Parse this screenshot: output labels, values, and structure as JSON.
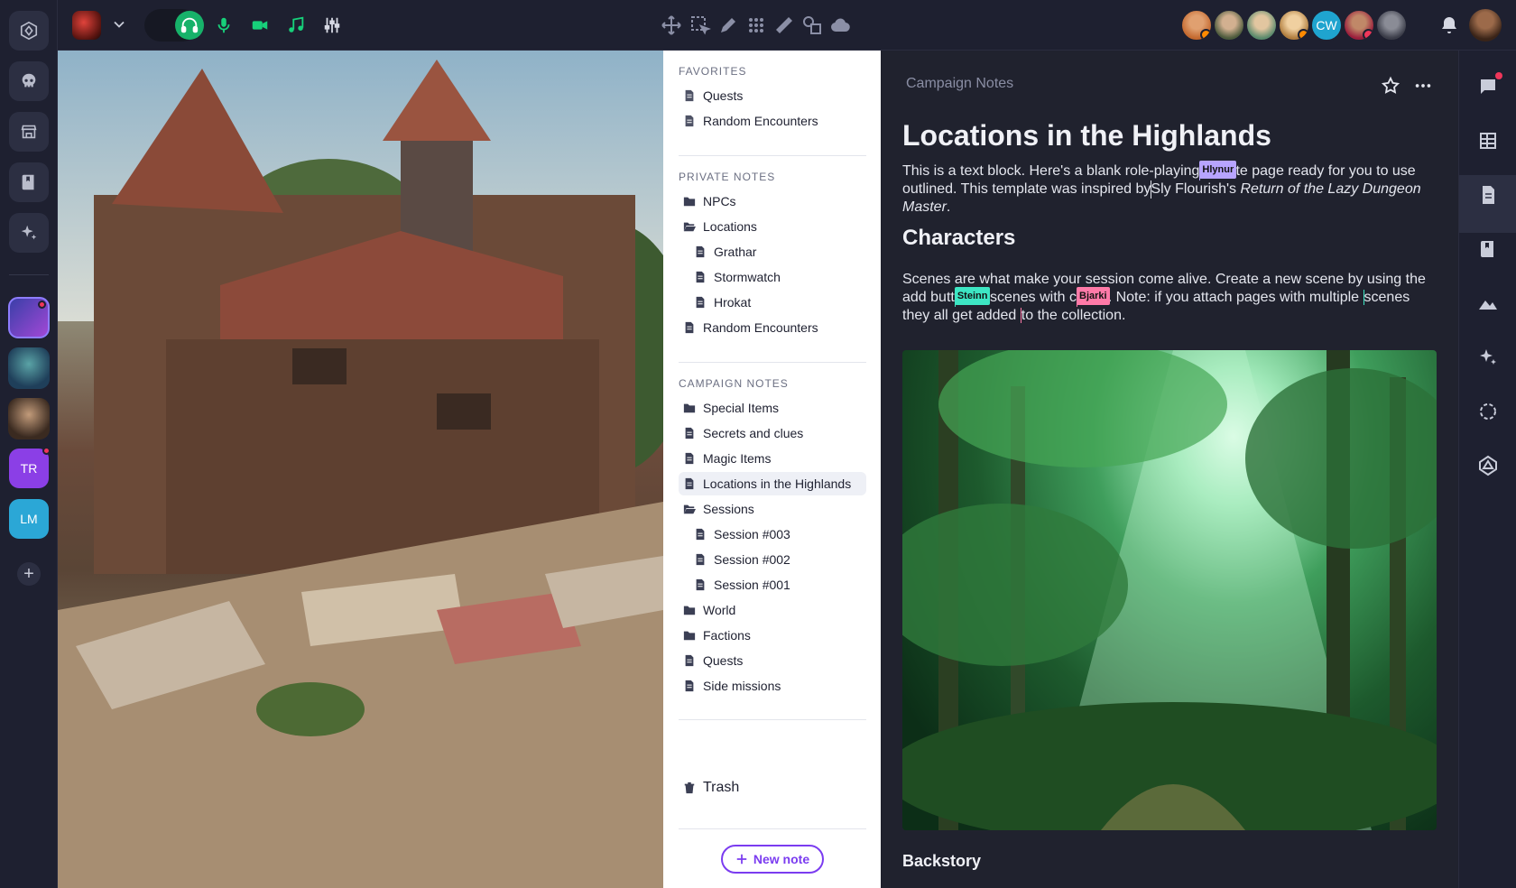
{
  "rail": {
    "items": [
      {
        "name": "app-logo-icon"
      },
      {
        "name": "skull-icon"
      },
      {
        "name": "store-icon"
      },
      {
        "name": "book-icon"
      },
      {
        "name": "sparkle-icon"
      }
    ],
    "groups": [
      {
        "initials": "TR",
        "color": "#8b3fe6",
        "unread": true
      },
      {
        "initials": "LM",
        "color": "#2ba7d6",
        "unread": false
      }
    ]
  },
  "topbar": {
    "tools": [
      "move-icon",
      "select-icon",
      "pen-icon",
      "grid-icon",
      "ruler-icon",
      "shapes-icon",
      "cloud-icon"
    ],
    "avatars": [
      {
        "color": "#c4692f",
        "badge": true
      },
      {
        "color": "#6a7c56",
        "badge": false
      },
      {
        "color": "#c9a071",
        "badge": false
      },
      {
        "color": "#d7a66e",
        "badge": true
      },
      {
        "initials": "CW",
        "color": "#1fa4cf",
        "badge": false
      },
      {
        "color": "#9b1e3c",
        "badge": true,
        "muted": true
      },
      {
        "color": "#4a4c5a",
        "badge": false
      }
    ]
  },
  "notes": {
    "favorites_heading": "FAVORITES",
    "favorites": [
      "Quests",
      "Random Encounters"
    ],
    "private_heading": "PRIVATE NOTES",
    "private": [
      {
        "label": "NPCs",
        "type": "folder"
      },
      {
        "label": "Locations",
        "type": "folder-open"
      },
      {
        "label": "Grathar",
        "type": "doc",
        "sub": true
      },
      {
        "label": "Stormwatch",
        "type": "doc",
        "sub": true
      },
      {
        "label": "Hrokat",
        "type": "doc",
        "sub": true
      },
      {
        "label": "Random Encounters",
        "type": "doc"
      }
    ],
    "campaign_heading": "CAMPAIGN NOTES",
    "campaign": [
      {
        "label": "Special Items",
        "type": "folder"
      },
      {
        "label": "Secrets and clues",
        "type": "doc"
      },
      {
        "label": "Magic Items",
        "type": "doc"
      },
      {
        "label": "Locations in the Highlands",
        "type": "doc",
        "active": true
      },
      {
        "label": "Sessions",
        "type": "folder-open"
      },
      {
        "label": "Session #003",
        "type": "doc",
        "sub": true
      },
      {
        "label": "Session #002",
        "type": "doc",
        "sub": true
      },
      {
        "label": "Session #001",
        "type": "doc",
        "sub": true
      },
      {
        "label": "World",
        "type": "folder"
      },
      {
        "label": "Factions",
        "type": "folder"
      },
      {
        "label": "Quests",
        "type": "doc"
      },
      {
        "label": "Side missions",
        "type": "doc"
      }
    ],
    "trash_label": "Trash",
    "new_note_label": "New note"
  },
  "editor": {
    "breadcrumb": "Campaign Notes",
    "title": "Locations in the Highlands",
    "intro_a": "This is a text block. Here's a blank role-playing",
    "intro_b": "an note page ready for you to use outlined. This template was inspired by",
    "intro_c": "Sly Flourish's ",
    "intro_italic": "Return of the Lazy Dungeon Master",
    "intro_end": ".",
    "heading_characters": "Characters",
    "chars_a": "Scenes are what make your session come alive. Create a new scene by using the add butt",
    "chars_b": "ttach scenes with c",
    "chars_c": " tags. Note: if you attach pages with multiple",
    "chars_d": "scenes they all get added",
    "chars_e": "to the collection.",
    "cursors": {
      "hlynur": {
        "name": "Hlynur",
        "color": "#b7a4ff"
      },
      "steinn": {
        "name": "Steinn",
        "color": "#3de6c4"
      },
      "bjarki": {
        "name": "Bjarki",
        "color": "#ff7aa8"
      }
    },
    "heading_backstory": "Backstory"
  },
  "right_panel": [
    "chat-icon",
    "table-icon",
    "document-icon",
    "book-icon",
    "landscape-icon",
    "sparkle-icon",
    "dice-icon",
    "d20-icon"
  ]
}
